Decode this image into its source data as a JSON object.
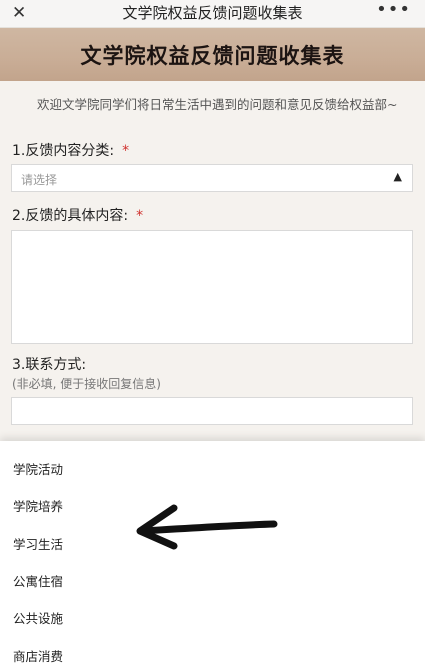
{
  "nav": {
    "close_icon": "close-icon",
    "title": "文学院权益反馈问题收集表",
    "more_icon": "more-icon"
  },
  "banner": {
    "title": "文学院权益反馈问题收集表"
  },
  "form": {
    "intro": "欢迎文学院同学们将日常生活中遇到的问题和意见反馈给权益部~",
    "q1": {
      "label": "1.反馈内容分类:",
      "required_mark": "*",
      "placeholder": "请选择"
    },
    "q2": {
      "label": "2.反馈的具体内容:",
      "required_mark": "*"
    },
    "q3": {
      "label": "3.联系方式:",
      "hint": "(非必填, 便于接收回复信息)"
    }
  },
  "dropdown": {
    "options": [
      "学院活动",
      "学院培养",
      "学习生活",
      "公寓住宿",
      "公共设施",
      "商店消费"
    ]
  },
  "colors": {
    "banner": "#c9ad96",
    "required": "#d0312d"
  }
}
